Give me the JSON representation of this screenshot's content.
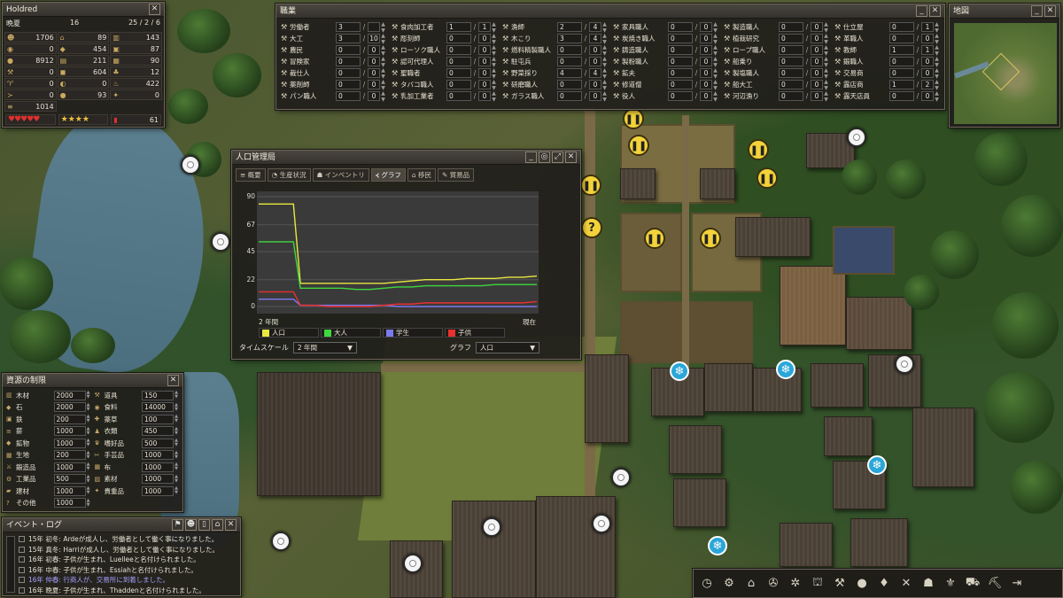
{
  "town": {
    "name": "Holdred",
    "season": "晩夏",
    "day": "16",
    "date": "25 / 2 / 6",
    "stats": [
      {
        "icon": "people-icon",
        "value": "1706"
      },
      {
        "icon": "house-icon",
        "value": "89"
      },
      {
        "icon": "wood-icon",
        "value": "143"
      },
      {
        "icon": "food-icon",
        "value": "0"
      },
      {
        "icon": "stone-icon",
        "value": "454"
      },
      {
        "icon": "iron-icon",
        "value": "87"
      },
      {
        "icon": "coin-icon",
        "value": "8912"
      },
      {
        "icon": "leather-icon",
        "value": "211"
      },
      {
        "icon": "cloth-icon",
        "value": "90"
      },
      {
        "icon": "tool-icon",
        "value": "0"
      },
      {
        "icon": "coal-icon",
        "value": "604"
      },
      {
        "icon": "herb-icon",
        "value": "12"
      },
      {
        "icon": "wheat-icon",
        "value": "0"
      },
      {
        "icon": "meat-icon",
        "value": "0"
      },
      {
        "icon": "fire-icon",
        "value": "422"
      },
      {
        "icon": "fish-icon",
        "value": "0"
      },
      {
        "icon": "fruit-icon",
        "value": "93"
      },
      {
        "icon": "gold-icon",
        "value": "0"
      },
      {
        "icon": "firewood-icon",
        "value": "1014"
      }
    ],
    "happiness": "♥♥♥♥♥",
    "rating": "★★★★",
    "health": "61"
  },
  "professions": {
    "title": "職業",
    "items": [
      {
        "icon": "laborer-icon",
        "label": "労働者",
        "cur": "3",
        "max": ""
      },
      {
        "icon": "builder-icon",
        "label": "大工",
        "cur": "3",
        "max": "10"
      },
      {
        "icon": "farmer-icon",
        "label": "農民",
        "cur": "0",
        "max": "0"
      },
      {
        "icon": "hunter-icon",
        "label": "冒険家",
        "cur": "0",
        "max": "0"
      },
      {
        "icon": "tailor-icon",
        "label": "裁仕人",
        "cur": "0",
        "max": "0"
      },
      {
        "icon": "herbalist-icon",
        "label": "薬剤師",
        "cur": "0",
        "max": "0"
      },
      {
        "icon": "baker-icon",
        "label": "パン職人",
        "cur": "0",
        "max": "0"
      },
      {
        "icon": "butcher-icon",
        "label": "食肉加工者",
        "cur": "1",
        "max": "1"
      },
      {
        "icon": "sculptor-icon",
        "label": "彫刻師",
        "cur": "0",
        "max": "0"
      },
      {
        "icon": "rope-icon",
        "label": "ローソク職人",
        "cur": "0",
        "max": "0"
      },
      {
        "icon": "agent-icon",
        "label": "認可代理人",
        "cur": "0",
        "max": "0"
      },
      {
        "icon": "saint-icon",
        "label": "聖職者",
        "cur": "0",
        "max": "0"
      },
      {
        "icon": "pipe-icon",
        "label": "タバコ職人",
        "cur": "0",
        "max": "0"
      },
      {
        "icon": "dairy-icon",
        "label": "乳加工業者",
        "cur": "0",
        "max": "0"
      },
      {
        "icon": "fisher-icon",
        "label": "漁師",
        "cur": "2",
        "max": "4"
      },
      {
        "icon": "woodcutter-icon",
        "label": "木こり",
        "cur": "3",
        "max": "4"
      },
      {
        "icon": "fuel-icon",
        "label": "燃料精製職人",
        "cur": "0",
        "max": "0"
      },
      {
        "icon": "guard-icon",
        "label": "駐屯兵",
        "cur": "0",
        "max": "0"
      },
      {
        "icon": "vegetable-icon",
        "label": "野菜採り",
        "cur": "4",
        "max": "4"
      },
      {
        "icon": "grinder-icon",
        "label": "研磨職人",
        "cur": "0",
        "max": "0"
      },
      {
        "icon": "glass-icon",
        "label": "ガラス職人",
        "cur": "0",
        "max": "0"
      },
      {
        "icon": "furniture-icon",
        "label": "家具職人",
        "cur": "0",
        "max": "0"
      },
      {
        "icon": "charcoal-icon",
        "label": "炭焼き職人",
        "cur": "0",
        "max": "0"
      },
      {
        "icon": "smith-icon",
        "label": "鋳造職人",
        "cur": "0",
        "max": "0"
      },
      {
        "icon": "salt-icon",
        "label": "製粉職人",
        "cur": "0",
        "max": "0"
      },
      {
        "icon": "miner-icon",
        "label": "鉱夫",
        "cur": "0",
        "max": "0"
      },
      {
        "icon": "monk-icon",
        "label": "修道僧",
        "cur": "0",
        "max": "0"
      },
      {
        "icon": "clerk-icon",
        "label": "役人",
        "cur": "0",
        "max": "0"
      },
      {
        "icon": "brewer-icon",
        "label": "製造職人",
        "cur": "0",
        "max": "0"
      },
      {
        "icon": "planter-icon",
        "label": "植栽研究",
        "cur": "0",
        "max": "0"
      },
      {
        "icon": "ropemaker-icon",
        "label": "ロープ職人",
        "cur": "0",
        "max": "0"
      },
      {
        "icon": "boatman-icon",
        "label": "船乗り",
        "cur": "0",
        "max": "0"
      },
      {
        "icon": "stonemason-icon",
        "label": "製塩職人",
        "cur": "0",
        "max": "0"
      },
      {
        "icon": "shipwright-icon",
        "label": "船大工",
        "cur": "0",
        "max": "0"
      },
      {
        "icon": "dredger-icon",
        "label": "河辺漁り",
        "cur": "0",
        "max": "0"
      },
      {
        "icon": "tailor2-icon",
        "label": "仕立屋",
        "cur": "0",
        "max": "1"
      },
      {
        "icon": "weaver-icon",
        "label": "革職人",
        "cur": "0",
        "max": "0"
      },
      {
        "icon": "teacher-icon",
        "label": "教師",
        "cur": "1",
        "max": "1"
      },
      {
        "icon": "blacksmith-icon",
        "label": "鍛職人",
        "cur": "0",
        "max": "0"
      },
      {
        "icon": "trader-icon",
        "label": "交易商",
        "cur": "0",
        "max": "0"
      },
      {
        "icon": "vendor-icon",
        "label": "露店商",
        "cur": "1",
        "max": "2"
      },
      {
        "icon": "market-icon",
        "label": "露天店員",
        "cur": "0",
        "max": "0"
      }
    ]
  },
  "minimap": {
    "title": "地図"
  },
  "population": {
    "title": "人口管理局",
    "tabs": [
      "概要",
      "生産状況",
      "インベントリ",
      "グラフ",
      "移民",
      "貿易品"
    ],
    "active_tab": "グラフ",
    "time_scale_label": "タイムスケール",
    "time_scale_value": "2 年間",
    "graph_label": "グラフ",
    "graph_value": "人口",
    "x_start": "2 年間",
    "x_end": "現在"
  },
  "chart_data": {
    "type": "line",
    "title": "",
    "ylim": [
      0,
      90
    ],
    "yticks": [
      90,
      67,
      45,
      22,
      0
    ],
    "x": [
      0,
      2,
      4,
      5,
      6,
      7,
      8,
      10,
      12,
      14,
      16,
      18,
      20,
      22,
      24,
      26,
      28,
      30,
      32,
      34,
      36,
      38,
      40
    ],
    "series": [
      {
        "name": "人口",
        "color": "#e8e840",
        "values": [
          84,
          84,
          84,
          84,
          19,
          19,
          19,
          19,
          19,
          19,
          19,
          19,
          20,
          21,
          22,
          22,
          22,
          23,
          23,
          23,
          24,
          24,
          25
        ]
      },
      {
        "name": "大人",
        "color": "#3ed83e",
        "values": [
          53,
          53,
          53,
          53,
          15,
          15,
          15,
          15,
          15,
          14,
          14,
          15,
          16,
          16,
          17,
          17,
          17,
          17,
          17,
          18,
          18,
          18,
          18
        ]
      },
      {
        "name": "学生",
        "color": "#7a7af0",
        "values": [
          6,
          6,
          6,
          6,
          1,
          1,
          1,
          1,
          1,
          1,
          1,
          1,
          0,
          0,
          0,
          0,
          0,
          0,
          0,
          0,
          0,
          0,
          0
        ]
      },
      {
        "name": "子供",
        "color": "#e83030",
        "values": [
          12,
          12,
          12,
          12,
          1,
          1,
          1,
          0,
          0,
          0,
          0,
          1,
          2,
          2,
          3,
          3,
          3,
          3,
          3,
          3,
          3,
          3,
          4
        ]
      }
    ]
  },
  "resources": {
    "title": "資源の制限",
    "items": [
      {
        "icon": "wood-icon",
        "label": "木材",
        "value": "2000"
      },
      {
        "icon": "tools-icon",
        "label": "道具",
        "value": "150"
      },
      {
        "icon": "stone-icon",
        "label": "石",
        "value": "2000"
      },
      {
        "icon": "food-icon",
        "label": "食料",
        "value": "14000"
      },
      {
        "icon": "iron-icon",
        "label": "鉄",
        "value": "200"
      },
      {
        "icon": "medicine-icon",
        "label": "薬草",
        "value": "100"
      },
      {
        "icon": "firewood-icon",
        "label": "薪",
        "value": "1000"
      },
      {
        "icon": "clothing-icon",
        "label": "衣類",
        "value": "450"
      },
      {
        "icon": "ore-icon",
        "label": "鉱物",
        "value": "1000"
      },
      {
        "icon": "luxury-icon",
        "label": "嗜好品",
        "value": "500"
      },
      {
        "icon": "fabric-icon",
        "label": "生地",
        "value": "200"
      },
      {
        "icon": "craft-icon",
        "label": "手芸品",
        "value": "1000"
      },
      {
        "icon": "forged-icon",
        "label": "鍛造品",
        "value": "1000"
      },
      {
        "icon": "cloth-icon",
        "label": "布",
        "value": "1000"
      },
      {
        "icon": "industrial-icon",
        "label": "工業品",
        "value": "500"
      },
      {
        "icon": "material-icon",
        "label": "素材",
        "value": "1000"
      },
      {
        "icon": "building-icon",
        "label": "建材",
        "value": "1000"
      },
      {
        "icon": "treasure-icon",
        "label": "貴重品",
        "value": "1000"
      },
      {
        "icon": "misc-icon",
        "label": "その他",
        "value": "1000"
      }
    ]
  },
  "event_log": {
    "title": "イベント・ログ",
    "lines": [
      {
        "text": "15年 初冬: Ardeが成人し、労働者として働く事になりました。",
        "highlight": false
      },
      {
        "text": "15年 真冬: Harriが成人し、労働者として働く事になりました。",
        "highlight": false
      },
      {
        "text": "16年 初春: 子供が生まれ、Luelleeと名付けられました。",
        "highlight": false
      },
      {
        "text": "16年 中春: 子供が生まれ、Essiahと名付けられました。",
        "highlight": false
      },
      {
        "text": "16年 仲春: 行商人が、交易所に到着しました。",
        "highlight": true
      },
      {
        "text": "16年 晩夏: 子供が生まれ、Thaddenと名付けられました。",
        "highlight": false
      }
    ]
  },
  "toolbar": {
    "buttons": [
      {
        "name": "clock-icon",
        "glyph": "◷"
      },
      {
        "name": "gear-icon",
        "glyph": "⚙"
      },
      {
        "name": "house-icon",
        "glyph": "⌂"
      },
      {
        "name": "wheel-icon",
        "glyph": "✇"
      },
      {
        "name": "cog-icon",
        "glyph": "✲"
      },
      {
        "name": "barn-icon",
        "glyph": "⛫"
      },
      {
        "name": "hammer-icon",
        "glyph": "⚒"
      },
      {
        "name": "apple-icon",
        "glyph": "●"
      },
      {
        "name": "drop-icon",
        "glyph": "♦"
      },
      {
        "name": "cross-tools-icon",
        "glyph": "✕"
      },
      {
        "name": "group-icon",
        "glyph": "☗"
      },
      {
        "name": "fleur-icon",
        "glyph": "⚜"
      },
      {
        "name": "wagon-icon",
        "glyph": "⛟"
      },
      {
        "name": "pickaxe-icon",
        "glyph": "⛏"
      },
      {
        "name": "exit-icon",
        "glyph": "⇥"
      }
    ]
  }
}
